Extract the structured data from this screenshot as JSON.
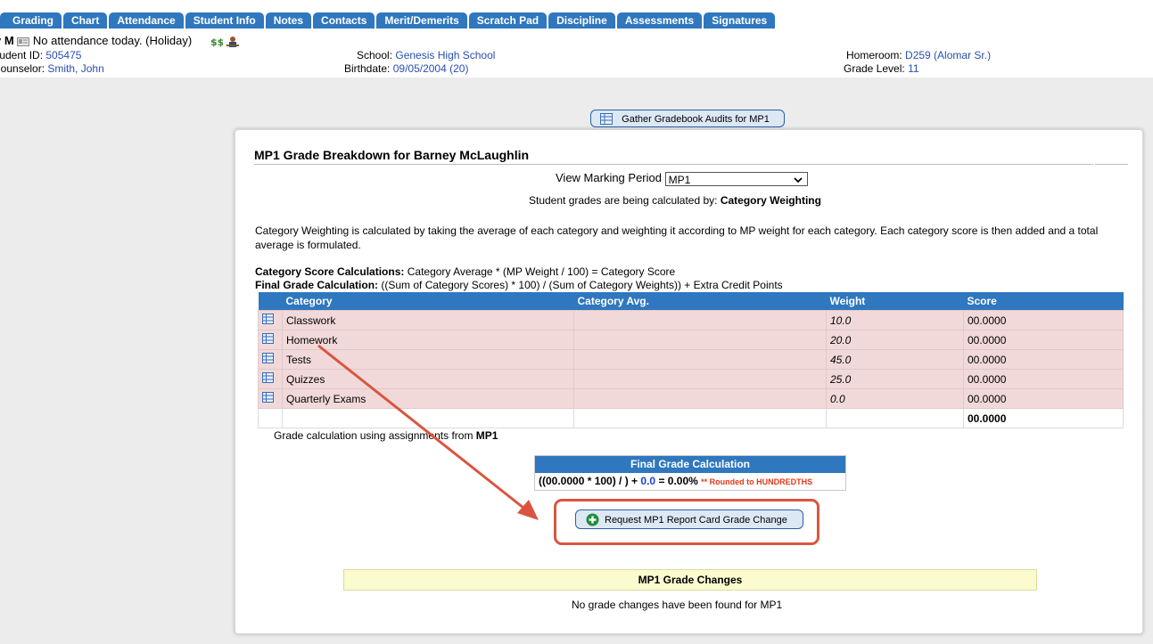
{
  "tabs": [
    "Grading",
    "Chart",
    "Attendance",
    "Student Info",
    "Notes",
    "Contacts",
    "Merit/Demerits",
    "Scratch Pad",
    "Discipline",
    "Assessments",
    "Signatures"
  ],
  "student": {
    "name_partial": "y M",
    "attendance": "No attendance today. (Holiday)",
    "id_label": "tudent ID:",
    "id_value": "505475",
    "counselor_label": "Counselor:",
    "counselor_value": "Smith, John",
    "school_label": "School:",
    "school_value": "Genesis High School",
    "birthdate_label": "Birthdate:",
    "birthdate_value": "09/05/2004 (20)",
    "homeroom_label": "Homeroom:",
    "homeroom_value": "D259 (Alomar Sr.)",
    "grade_label": "Grade Level:",
    "grade_value": "11"
  },
  "gather_button": "Gather Gradebook Audits for MP1",
  "panel": {
    "title": "MP1 Grade Breakdown for Barney McLaughlin",
    "view_mp_label": "View Marking Period",
    "mp_selected": "MP1",
    "calc_by_prefix": "Student grades are being calculated by:",
    "calc_by_method": "Category Weighting",
    "description": "Category Weighting is calculated by taking the average of each category and weighting it according to MP weight for each category. Each category score is then added and a total average is formulated.",
    "formula1_label": "Category Score Calculations:",
    "formula1_text": "Category Average * (MP Weight / 100) = Category Score",
    "formula2_label": "Final Grade Calculation:",
    "formula2_text": "((Sum of Category Scores) * 100) / (Sum of Category Weights)) + Extra Credit Points"
  },
  "table": {
    "headers": [
      "Category",
      "Category Avg.",
      "Weight",
      "Score"
    ],
    "rows": [
      {
        "category": "Classwork",
        "avg": "",
        "weight": "10.0",
        "score": "00.0000"
      },
      {
        "category": "Homework",
        "avg": "",
        "weight": "20.0",
        "score": "00.0000"
      },
      {
        "category": "Tests",
        "avg": "",
        "weight": "45.0",
        "score": "00.0000"
      },
      {
        "category": "Quizzes",
        "avg": "",
        "weight": "25.0",
        "score": "00.0000"
      },
      {
        "category": "Quarterly Exams",
        "avg": "",
        "weight": "0.0",
        "score": "00.0000"
      }
    ],
    "total_score": "00.0000"
  },
  "using": {
    "prefix": "Grade calculation using assignments from",
    "mp": "MP1"
  },
  "final_calc": {
    "header": "Final Grade Calculation",
    "expr_left": "((00.0000 * 100) / ) +",
    "extra": "0.0",
    "result": "= 0.00%",
    "rounding": "** Rounded to HUNDREDTHS"
  },
  "request_button": "Request MP1 Report Card Grade Change",
  "grade_changes": {
    "header": "MP1 Grade Changes",
    "empty": "No grade changes have been found for MP1"
  },
  "colors": {
    "tab_blue": "#2f77be",
    "link_blue": "#2a4fb0",
    "annotation_red": "#d95540",
    "row_pink": "#f2d9d9"
  }
}
